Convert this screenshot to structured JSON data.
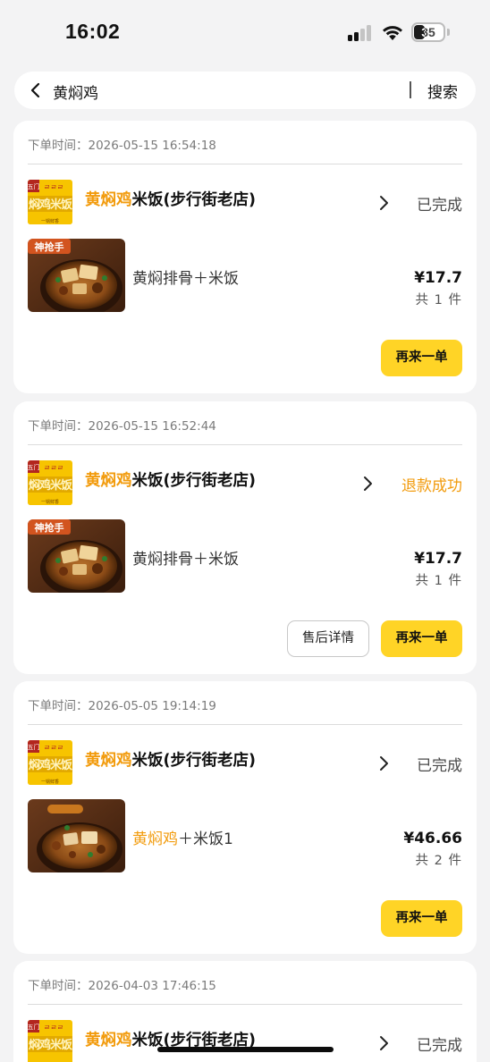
{
  "status_bar": {
    "time": "16:02",
    "battery": "35",
    "icons": [
      "signal-icon",
      "wifi-icon",
      "battery-icon"
    ]
  },
  "search": {
    "query": "黄焖鸡",
    "button_label": "搜索",
    "icons": [
      "back-arrow-icon"
    ]
  },
  "colors": {
    "accent": "#f29b0c",
    "button_yellow": "#ffd426",
    "background": "#f3f3f4"
  },
  "orders": [
    {
      "time": "下单时间：2026-05-15 16:54:18",
      "shop_name_highlight": "黄焖鸡",
      "shop_name_rest": "米饭(步行街老店)",
      "status": "已完成",
      "goods_name_highlight": "",
      "goods_name_rest": "黄焖排骨＋米饭",
      "thumb_badge": "神抢手",
      "price": "¥17.7",
      "count": "共 1 件",
      "after_sale_label": "",
      "reorder_label": "再来一单"
    },
    {
      "time": "下单时间：2026-05-15 16:52:44",
      "shop_name_highlight": "黄焖鸡",
      "shop_name_rest": "米饭(步行街老店)",
      "status": "退款成功",
      "goods_name_highlight": "",
      "goods_name_rest": "黄焖排骨＋米饭",
      "thumb_badge": "神抢手",
      "price": "¥17.7",
      "count": "共 1 件",
      "after_sale_label": "售后详情",
      "reorder_label": "再来一单"
    },
    {
      "time": "下单时间：2026-05-05 19:14:19",
      "shop_name_highlight": "黄焖鸡",
      "shop_name_rest": "米饭(步行街老店)",
      "status": "已完成",
      "goods_name_highlight": "黄焖鸡",
      "goods_name_rest": "＋米饭1",
      "thumb_badge": "",
      "price": "¥46.66",
      "count": "共 2 件",
      "after_sale_label": "",
      "reorder_label": "再来一单"
    },
    {
      "time": "下单时间：2026-04-03 17:46:15",
      "shop_name_highlight": "黄焖鸡",
      "shop_name_rest": "米饭(步行街老店)",
      "status": "已完成"
    }
  ]
}
